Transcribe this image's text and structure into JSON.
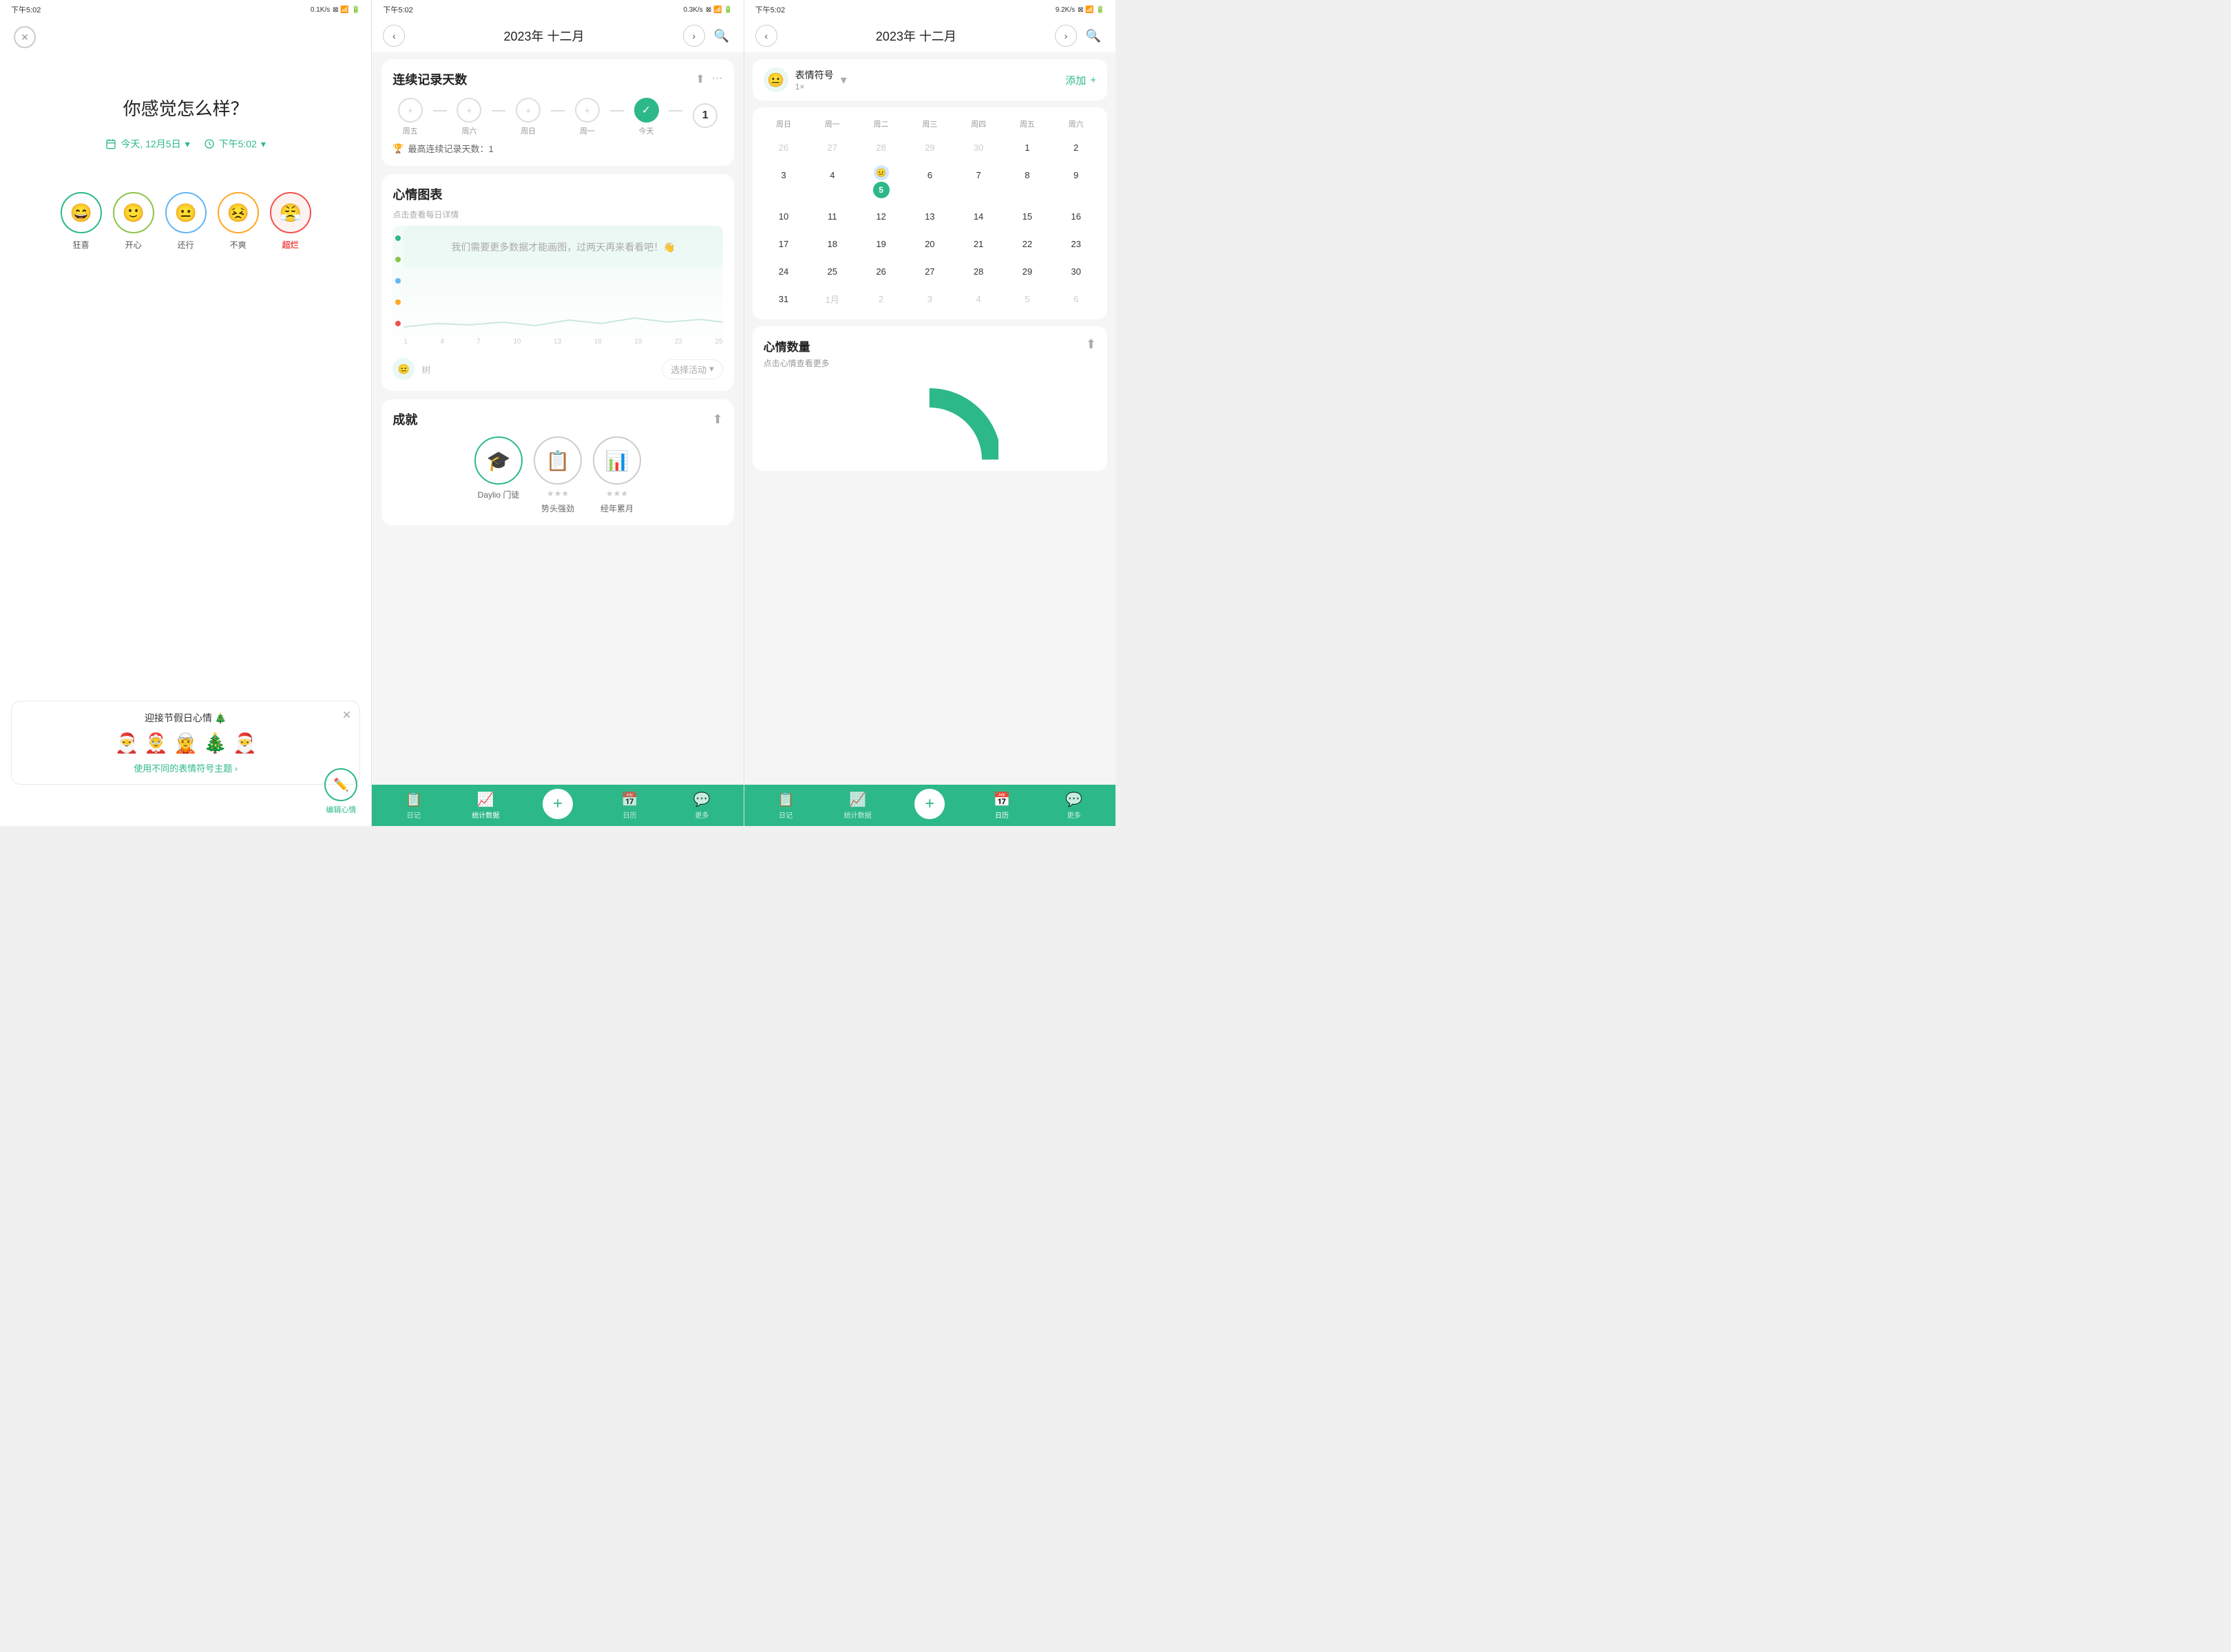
{
  "status_bar": {
    "time": "下午5:02",
    "signal1": "0.1K/s",
    "signal2": "0.3K/s",
    "signal3": "9.2K/s",
    "battery": "83"
  },
  "panel1": {
    "question": "你感觉怎么样？",
    "date_label": "今天, 12月5日",
    "time_label": "下午5:02",
    "moods": [
      {
        "label": "狂喜",
        "emoji": "😄",
        "color": "#2db88a"
      },
      {
        "label": "开心",
        "emoji": "🙂",
        "color": "#8bc34a"
      },
      {
        "label": "还行",
        "emoji": "😐",
        "color": "#64b5f6"
      },
      {
        "label": "不爽",
        "emoji": "😣",
        "color": "#ffa726"
      },
      {
        "label": "超烂",
        "emoji": "😤",
        "color": "#ef5350",
        "active": true
      }
    ],
    "promo_title": "迎接节假日心情 🎄",
    "promo_link": "使用不同的表情符号主题 ›",
    "edit_label": "编辑心情"
  },
  "panel2": {
    "month_title": "2023年 十二月",
    "streak_title": "连续记录天数",
    "streak_days": [
      {
        "label": "周五",
        "type": "empty"
      },
      {
        "label": "周六",
        "type": "empty"
      },
      {
        "label": "周日",
        "type": "empty"
      },
      {
        "label": "周一",
        "type": "empty"
      },
      {
        "label": "今天",
        "type": "active"
      },
      {
        "label": "",
        "type": "number",
        "value": "1"
      }
    ],
    "best_streak": "最高连续记录天数：1",
    "mood_chart_title": "心情图表",
    "chart_subtitle": "点击查看每日详情",
    "no_data_msg": "我们需要更多数据才能画图，过两天再来看看吧！👋",
    "achievements_title": "成就",
    "achievements": [
      {
        "label": "Daylio 门徒",
        "emoji": "🎓",
        "active": true,
        "stars": ""
      },
      {
        "label": "势头强劲",
        "emoji": "📋",
        "active": false,
        "stars": "★★★"
      },
      {
        "label": "经年累月",
        "emoji": "📊",
        "active": false,
        "stars": "★★★"
      }
    ],
    "nav": {
      "items": [
        {
          "icon": "📋",
          "label": "日记",
          "active": false
        },
        {
          "icon": "📈",
          "label": "统计数据",
          "active": true
        },
        {
          "icon": "+",
          "label": "",
          "is_add": true
        },
        {
          "icon": "📅",
          "label": "日历",
          "active": false
        },
        {
          "icon": "💬",
          "label": "更多",
          "active": false
        }
      ]
    }
  },
  "panel3": {
    "month_title": "2023年 十二月",
    "filter_label": "表情符号",
    "filter_count": "1×",
    "add_label": "添加",
    "calendar": {
      "headers": [
        "周日",
        "周一",
        "周二",
        "周三",
        "周四",
        "周五",
        "周六"
      ],
      "weeks": [
        [
          {
            "day": "26",
            "other": true
          },
          {
            "day": "27",
            "other": true
          },
          {
            "day": "28",
            "other": true
          },
          {
            "day": "29",
            "other": true
          },
          {
            "day": "30",
            "other": true
          },
          {
            "day": "1",
            "other": false
          },
          {
            "day": "2",
            "other": false
          }
        ],
        [
          {
            "day": "3",
            "other": false
          },
          {
            "day": "4",
            "other": false
          },
          {
            "day": "5",
            "today": true,
            "mood": "😐"
          },
          {
            "day": "6",
            "other": false
          },
          {
            "day": "7",
            "other": false
          },
          {
            "day": "8",
            "other": false
          },
          {
            "day": "9",
            "other": false
          }
        ],
        [
          {
            "day": "10",
            "other": false
          },
          {
            "day": "11",
            "other": false
          },
          {
            "day": "12",
            "other": false
          },
          {
            "day": "13",
            "other": false
          },
          {
            "day": "14",
            "other": false
          },
          {
            "day": "15",
            "other": false
          },
          {
            "day": "16",
            "other": false
          }
        ],
        [
          {
            "day": "17",
            "other": false
          },
          {
            "day": "18",
            "other": false
          },
          {
            "day": "19",
            "other": false
          },
          {
            "day": "20",
            "other": false
          },
          {
            "day": "21",
            "other": false
          },
          {
            "day": "22",
            "other": false
          },
          {
            "day": "23",
            "other": false
          }
        ],
        [
          {
            "day": "24",
            "other": false
          },
          {
            "day": "25",
            "other": false
          },
          {
            "day": "26",
            "other": false
          },
          {
            "day": "27",
            "other": false
          },
          {
            "day": "28",
            "other": false
          },
          {
            "day": "29",
            "other": false
          },
          {
            "day": "30",
            "other": false
          }
        ],
        [
          {
            "day": "31",
            "other": false
          },
          {
            "day": "1",
            "other": true
          },
          {
            "day": "2",
            "other": true
          },
          {
            "day": "3",
            "other": true
          },
          {
            "day": "4",
            "other": true
          },
          {
            "day": "5",
            "other": true
          },
          {
            "day": "6",
            "other": true
          }
        ]
      ]
    },
    "mood_count_title": "心情数量",
    "mood_count_subtitle": "点击心情查看更多",
    "nav": {
      "items": [
        {
          "icon": "📋",
          "label": "日记",
          "active": false
        },
        {
          "icon": "📈",
          "label": "统计数据",
          "active": false
        },
        {
          "icon": "+",
          "label": "",
          "is_add": true
        },
        {
          "icon": "📅",
          "label": "日历",
          "active": true
        },
        {
          "icon": "💬",
          "label": "更多",
          "active": false
        }
      ]
    }
  }
}
